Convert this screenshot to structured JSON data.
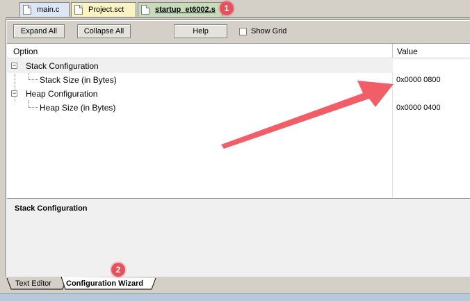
{
  "file_tabs": [
    {
      "label": "main.c"
    },
    {
      "label": "Project.sct"
    },
    {
      "label": "startup_et6002.s"
    }
  ],
  "badges": {
    "first": "1",
    "second": "2"
  },
  "toolbar": {
    "expand_all": "Expand All",
    "collapse_all": "Collapse All",
    "help": "Help",
    "show_grid": "Show Grid"
  },
  "columns": {
    "option": "Option",
    "value": "Value"
  },
  "tree": [
    {
      "label": "Stack Configuration",
      "toggle": "−",
      "children": [
        {
          "label": "Stack Size (in Bytes)",
          "value": "0x0000 0800"
        }
      ]
    },
    {
      "label": "Heap Configuration",
      "toggle": "−",
      "children": [
        {
          "label": "Heap Size (in Bytes)",
          "value": "0x0000 0400"
        }
      ]
    }
  ],
  "description": {
    "title": "Stack Configuration"
  },
  "view_tabs": [
    {
      "label": "Text Editor"
    },
    {
      "label": "Configuration Wizard"
    }
  ],
  "colors": {
    "annotation": "#e8505b",
    "selected_row": "#f0f0f0"
  }
}
